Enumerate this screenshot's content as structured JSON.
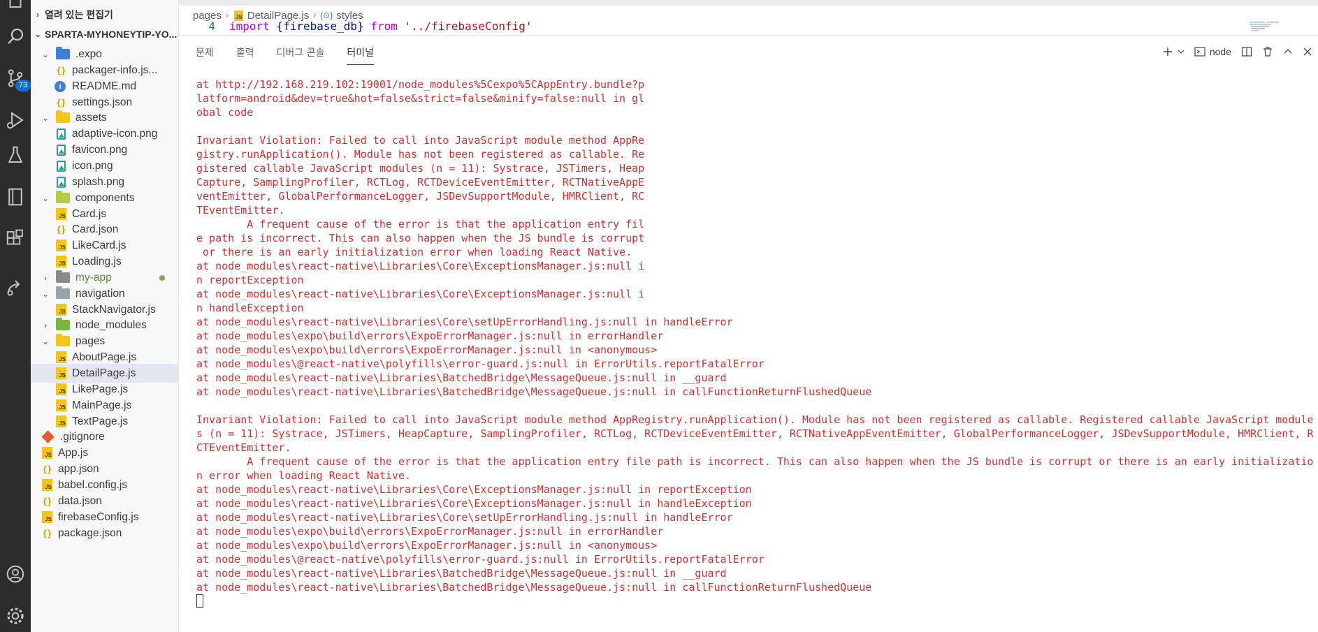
{
  "activity_bar": {
    "items": [
      {
        "icon": "files-icon"
      },
      {
        "icon": "search-icon"
      },
      {
        "icon": "source-control-icon",
        "badge": "73"
      },
      {
        "icon": "run-debug-icon"
      },
      {
        "icon": "testing-icon"
      },
      {
        "icon": "notebook-icon"
      },
      {
        "icon": "extensions-icon"
      },
      {
        "icon": "remote-icon"
      }
    ],
    "bottom": [
      {
        "icon": "account-icon"
      },
      {
        "icon": "settings-gear-icon"
      }
    ]
  },
  "explorer": {
    "open_editors_label": "열려 있는 편집기",
    "project_label": "SPARTA-MYHONEYTIP-YO...",
    "tree": [
      {
        "type": "folder",
        "name": ".expo",
        "expanded": true,
        "depth": 1,
        "color": "#3f7fd7"
      },
      {
        "type": "json",
        "name": "packager-info.js...",
        "depth": 2
      },
      {
        "type": "info",
        "name": "README.md",
        "depth": 2
      },
      {
        "type": "json",
        "name": "settings.json",
        "depth": 2
      },
      {
        "type": "folder",
        "name": "assets",
        "expanded": true,
        "depth": 1,
        "color": "#f5c518"
      },
      {
        "type": "image",
        "name": "adaptive-icon.png",
        "depth": 2
      },
      {
        "type": "image",
        "name": "favicon.png",
        "depth": 2
      },
      {
        "type": "image",
        "name": "icon.png",
        "depth": 2
      },
      {
        "type": "image",
        "name": "splash.png",
        "depth": 2
      },
      {
        "type": "folder",
        "name": "components",
        "expanded": true,
        "depth": 1,
        "color": "#b5cc4a"
      },
      {
        "type": "js",
        "name": "Card.js",
        "depth": 2
      },
      {
        "type": "json",
        "name": "Card.json",
        "depth": 2
      },
      {
        "type": "js",
        "name": "LikeCard.js",
        "depth": 2
      },
      {
        "type": "js",
        "name": "Loading.js",
        "depth": 2
      },
      {
        "type": "folder",
        "name": "my-app",
        "expanded": false,
        "depth": 1,
        "color": "#8a8a8a",
        "modified": true
      },
      {
        "type": "folder",
        "name": "navigation",
        "expanded": true,
        "depth": 1,
        "color": "#9aa4ad"
      },
      {
        "type": "js",
        "name": "StackNavigator.js",
        "depth": 2
      },
      {
        "type": "folder",
        "name": "node_modules",
        "expanded": false,
        "depth": 1,
        "color": "#7cb342"
      },
      {
        "type": "folder",
        "name": "pages",
        "expanded": true,
        "depth": 1,
        "color": "#f5c518"
      },
      {
        "type": "js",
        "name": "AboutPage.js",
        "depth": 2
      },
      {
        "type": "js",
        "name": "DetailPage.js",
        "depth": 2,
        "selected": true
      },
      {
        "type": "js",
        "name": "LikePage.js",
        "depth": 2
      },
      {
        "type": "js",
        "name": "MainPage.js",
        "depth": 2
      },
      {
        "type": "js",
        "name": "TextPage.js",
        "depth": 2
      },
      {
        "type": "git",
        "name": ".gitignore",
        "depth": 1
      },
      {
        "type": "js",
        "name": "App.js",
        "depth": 1
      },
      {
        "type": "json",
        "name": "app.json",
        "depth": 1
      },
      {
        "type": "js",
        "name": "babel.config.js",
        "depth": 1
      },
      {
        "type": "json",
        "name": "data.json",
        "depth": 1
      },
      {
        "type": "js",
        "name": "firebaseConfig.js",
        "depth": 1
      },
      {
        "type": "json",
        "name": "package.json",
        "depth": 1
      }
    ]
  },
  "editor": {
    "breadcrumb": [
      "pages",
      "DetailPage.js",
      "styles"
    ],
    "code_line": {
      "number": "4",
      "keyword": "import",
      "text": " {firebase_db} ",
      "from": "from",
      "string": " '../firebaseConfig'"
    }
  },
  "panel": {
    "tabs": [
      "문제",
      "출력",
      "디버그 콘솔",
      "터미널"
    ],
    "active_tab": "터미널",
    "terminal_name": "node",
    "error_color": "#cd3131",
    "terminal_lines": [
      "at http://192.168.219.102:19001/node_modules%5Cexpo%5CAppEntry.bundle?p",
      "latform=android&dev=true&hot=false&strict=false&minify=false:null in gl",
      "obal code",
      "",
      "Invariant Violation: Failed to call into JavaScript module method AppRe",
      "gistry.runApplication(). Module has not been registered as callable. Re",
      "gistered callable JavaScript modules (n = 11): Systrace, JSTimers, Heap",
      "Capture, SamplingProfiler, RCTLog, RCTDeviceEventEmitter, RCTNativeAppE",
      "ventEmitter, GlobalPerformanceLogger, JSDevSupportModule, HMRClient, RC",
      "TEventEmitter.",
      "        A frequent cause of the error is that the application entry fil",
      "e path is incorrect. This can also happen when the JS bundle is corrupt",
      " or there is an early initialization error when loading React Native.",
      "at node_modules\\react-native\\Libraries\\Core\\ExceptionsManager.js:null i",
      "n reportException",
      "at node_modules\\react-native\\Libraries\\Core\\ExceptionsManager.js:null i",
      "n handleException",
      "at node_modules\\react-native\\Libraries\\Core\\setUpErrorHandling.js:null in handleError",
      "at node_modules\\expo\\build\\errors\\ExpoErrorManager.js:null in errorHandler",
      "at node_modules\\expo\\build\\errors\\ExpoErrorManager.js:null in <anonymous>",
      "at node_modules\\@react-native\\polyfills\\error-guard.js:null in ErrorUtils.reportFatalError",
      "at node_modules\\react-native\\Libraries\\BatchedBridge\\MessageQueue.js:null in __guard",
      "at node_modules\\react-native\\Libraries\\BatchedBridge\\MessageQueue.js:null in callFunctionReturnFlushedQueue",
      "",
      "Invariant Violation: Failed to call into JavaScript module method AppRegistry.runApplication(). Module has not been registered as callable. Registered callable JavaScript module",
      "s (n = 11): Systrace, JSTimers, HeapCapture, SamplingProfiler, RCTLog, RCTDeviceEventEmitter, RCTNativeAppEventEmitter, GlobalPerformanceLogger, JSDevSupportModule, HMRClient, R",
      "CTEventEmitter.",
      "        A frequent cause of the error is that the application entry file path is incorrect. This can also happen when the JS bundle is corrupt or there is an early initializatio",
      "n error when loading React Native.",
      "at node_modules\\react-native\\Libraries\\Core\\ExceptionsManager.js:null in reportException",
      "at node_modules\\react-native\\Libraries\\Core\\ExceptionsManager.js:null in handleException",
      "at node_modules\\react-native\\Libraries\\Core\\setUpErrorHandling.js:null in handleError",
      "at node_modules\\expo\\build\\errors\\ExpoErrorManager.js:null in errorHandler",
      "at node_modules\\expo\\build\\errors\\ExpoErrorManager.js:null in <anonymous>",
      "at node_modules\\@react-native\\polyfills\\error-guard.js:null in ErrorUtils.reportFatalError",
      "at node_modules\\react-native\\Libraries\\BatchedBridge\\MessageQueue.js:null in __guard",
      "at node_modules\\react-native\\Libraries\\BatchedBridge\\MessageQueue.js:null in callFunctionReturnFlushedQueue"
    ]
  }
}
